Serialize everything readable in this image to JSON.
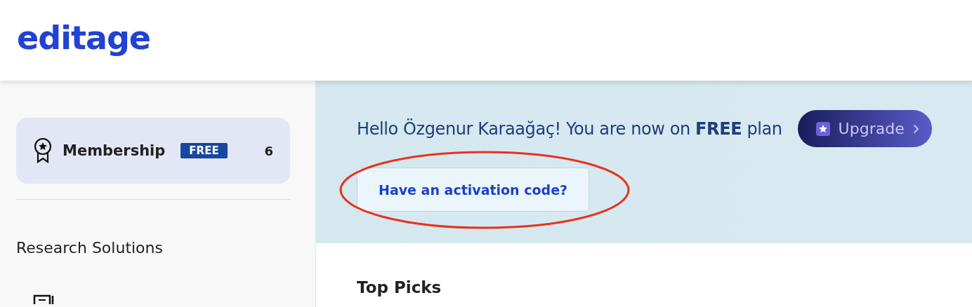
{
  "logo": {
    "text": "editage"
  },
  "sidebar": {
    "membership": {
      "label": "Membership",
      "badge": "FREE",
      "count": "6",
      "selected": true
    },
    "section_title": "Research Solutions"
  },
  "banner": {
    "greeting": "Hello Özgenur Karaağaç! You are now on **FREE** plan",
    "upgrade_button": "Upgrade",
    "activation_button": "Have an activation code?",
    "annotation": {
      "kind": "ellipse",
      "color": "#e8321e"
    }
  },
  "top_picks": {
    "title": "Top Picks"
  }
}
